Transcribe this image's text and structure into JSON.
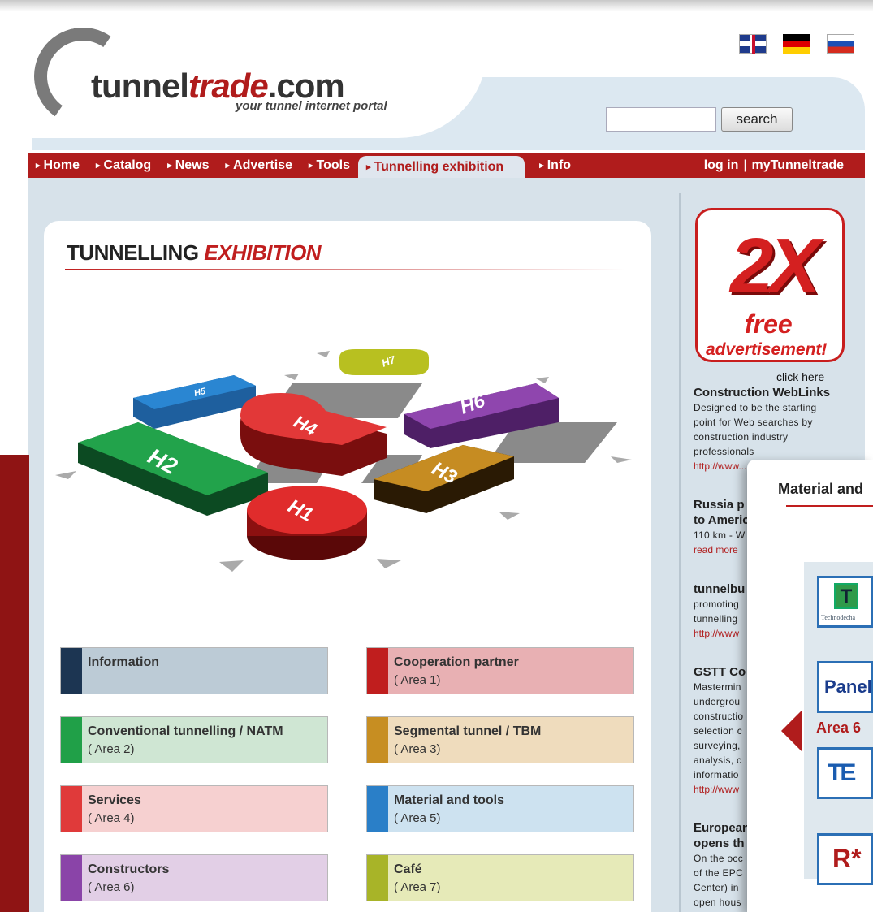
{
  "header": {
    "logo_main": "tunnel",
    "logo_accent": "trade",
    "logo_tld": ".com",
    "tagline": "your tunnel internet portal",
    "flags": [
      "uk-flag-icon",
      "germany-flag-icon",
      "russia-flag-icon"
    ],
    "search_placeholder": "",
    "search_button": "search"
  },
  "nav": {
    "items": [
      {
        "label": "Home"
      },
      {
        "label": "Catalog"
      },
      {
        "label": "News"
      },
      {
        "label": "Advertise"
      },
      {
        "label": "Tools"
      },
      {
        "label": "Tunnelling exhibition",
        "active": true
      },
      {
        "label": "Info"
      }
    ],
    "login": "log in",
    "sep": "|",
    "my": "myTunneltrade"
  },
  "main": {
    "title_part1": "TUNNELLING",
    "title_part2": "EXHIBITION",
    "halls": [
      "H1",
      "H2",
      "H3",
      "H4",
      "H5",
      "H6",
      "H7"
    ],
    "legend": [
      {
        "name": "Information",
        "area": "",
        "color": "#1c3552",
        "bg": "#bccbd6"
      },
      {
        "name": "Cooperation partner",
        "area": "( Area 1)",
        "color": "#c01e1e",
        "bg": "#e8b0b3"
      },
      {
        "name": "Conventional tunnelling / NATM",
        "area": "( Area 2)",
        "color": "#20a048",
        "bg": "#cfe6d3"
      },
      {
        "name": "Segmental tunnel / TBM",
        "area": "( Area 3)",
        "color": "#c78e22",
        "bg": "#efdcbd"
      },
      {
        "name": "Services",
        "area": "( Area 4)",
        "color": "#e03a3a",
        "bg": "#f6d0d0"
      },
      {
        "name": "Material and tools",
        "area": "( Area 5)",
        "color": "#2a7fc8",
        "bg": "#cde2f0"
      },
      {
        "name": "Constructors",
        "area": "( Area 6)",
        "color": "#8a44a8",
        "bg": "#e2cfe6"
      },
      {
        "name": "Café",
        "area": "( Area 7)",
        "color": "#a8b428",
        "bg": "#e6eab8"
      }
    ]
  },
  "sidebar": {
    "promo_big": "2X",
    "promo_free": "free",
    "promo_adv": "advertisement!",
    "promo_click": "click here",
    "news": [
      {
        "title": "Construction WebLinks",
        "text": "Designed to be the starting point for Web searches by construction industry professionals",
        "link": "http://www..."
      },
      {
        "title": "Russia p to Americ",
        "text": "110 km - W",
        "link": "read more"
      },
      {
        "title": "tunnelbu",
        "text": "promoting tunnelling",
        "link": "http://www"
      },
      {
        "title": "GSTT Co",
        "text": "Mastermin undergrou constructio selection c surveying, analysis, c informatio",
        "link": "http://www"
      },
      {
        "title": "European opens th",
        "text": "On the occ of the EPC Center) in open hous",
        "link": ""
      }
    ]
  },
  "overlay": {
    "title": "Material and",
    "area_label": "Area 6",
    "logos": [
      "T",
      "Panel",
      "TE",
      "R*"
    ],
    "logo1_caption": "Technodecha"
  }
}
